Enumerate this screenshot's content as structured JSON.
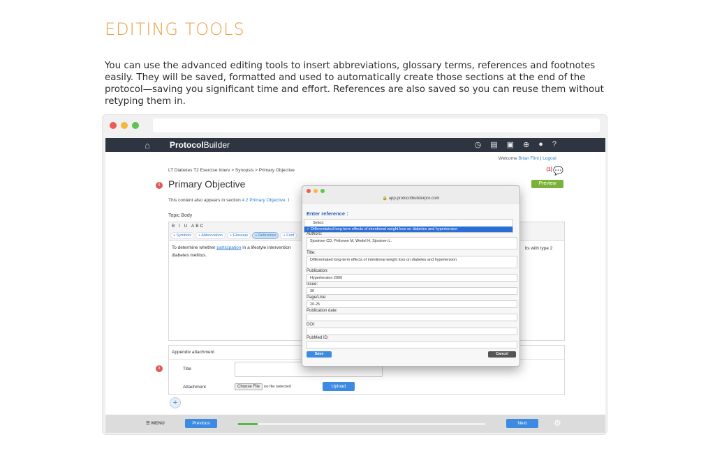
{
  "heading": "EDITING TOOLS",
  "intro": "You can use the advanced editing tools to insert abbreviations, glossary terms, references and footnotes easily. They will be saved, formatted and used to automatically create those sections at the end of the protocol—saving you significant time and effort. References are also saved so you can reuse them without retyping them in.",
  "app": {
    "brand_bold": "Protocol",
    "brand_rest": "Builder",
    "welcome": "Welcome",
    "user_name": "Brian Flint",
    "separator": "|",
    "logout": "Logout",
    "breadcrumb": "LT Diabetes T2 Exercise Interv > Synopsis > Primary Objective",
    "note_count": "(1)",
    "page_title": "Primary Objective",
    "preview": "Preview",
    "also_prefix": "This content also appears in section",
    "also_link": "4.2 Primary Objective",
    "also_suffix": ". I",
    "topic_label": "Topic Body",
    "toolbar_format": "B I U ABC",
    "pills": [
      "Symbols",
      "Abbreviation",
      "Glossary",
      "Reference",
      "Foot"
    ],
    "body_prefix": "To determine whether",
    "body_link": "participation",
    "body_mid": "in a lifestyle intervention",
    "body_tail": "lts with type 2",
    "body_line2": "diabetes mellitus.",
    "appendix_header": "Appendix attachment",
    "title_label": "Title",
    "attachment_label": "Attachment",
    "choose_file": "Choose File",
    "no_file": "no file selected",
    "upload": "Upload",
    "add": "+",
    "menu": "MENU",
    "previous": "Previous",
    "next": "Next",
    "progress_fraction": 0.08
  },
  "modal": {
    "url": "app.protocolbuilderpro.com",
    "heading": "Enter reference :",
    "select_placeholder": "Select",
    "select_selected": "✓ Differentiated long-term effects of intentional weight loss on diabetes and hypertension",
    "authors_label": "Authors:",
    "authors": "Sjostrom CD, Peltonen M, Wedel H, Sjostrom L.",
    "title_label": "Title:",
    "title": "Differentiated long-term effects of intentional weight loss on diabetes and hypertension",
    "publication_label": "Publication:",
    "publication": "Hypertension 2000",
    "issue_label": "Issue:",
    "issue": "36",
    "page_label": "Page/Line:",
    "page": "20-25",
    "pubdate_label": "Publication date:",
    "pubdate": "",
    "doi_label": "DOI:",
    "doi": "",
    "pubmed_label": "PubMed ID:",
    "pubmed": "",
    "save": "Save",
    "cancel": "Cancel"
  },
  "colors": {
    "heading": "#e8a045",
    "topbar": "#2f3540",
    "primary_button": "#3d8be0",
    "preview_button": "#7bb33a",
    "progress": "#58b846"
  }
}
